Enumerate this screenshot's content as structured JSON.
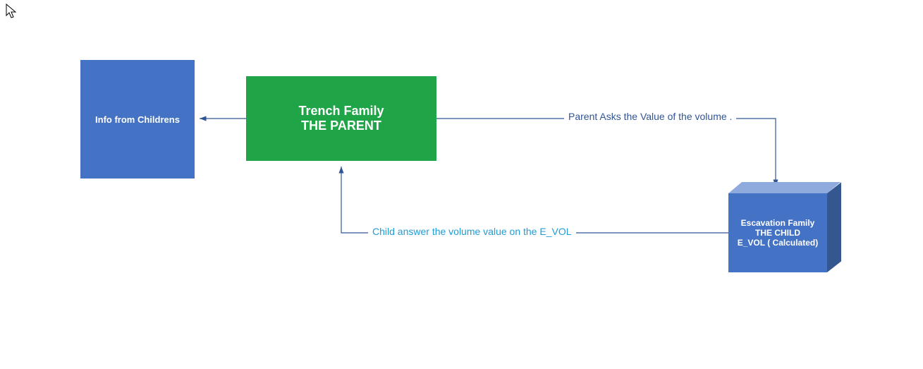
{
  "nodes": {
    "info": {
      "label": "Info from Childrens"
    },
    "parent": {
      "line1": "Trench Family",
      "line2": "THE PARENT"
    },
    "child": {
      "line1": "Escavation Family",
      "line2": "THE CHILD",
      "line3": "E_VOL  ( Calculated)"
    }
  },
  "connectors": {
    "ask": "Parent Asks the Value of the volume .",
    "answer": "Child answer the volume value on the E_VOL"
  },
  "colors": {
    "blue": "#4472C4",
    "green": "#1FA547",
    "darkblue": "#2F5597",
    "lightblue": "#1F9CD8"
  }
}
